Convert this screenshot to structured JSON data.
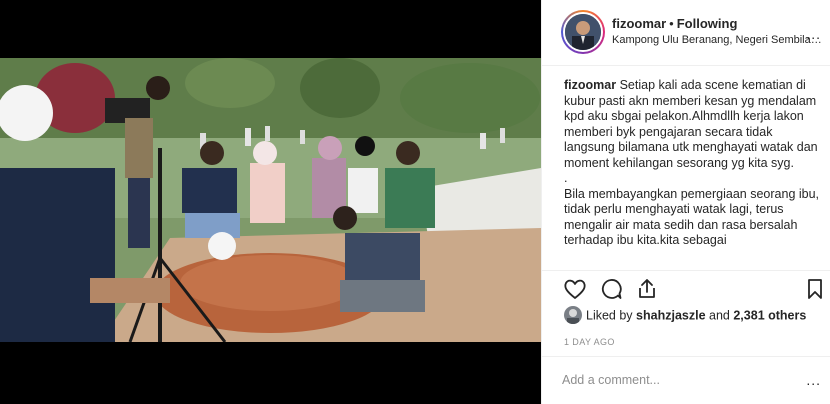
{
  "header": {
    "username": "fizoomar",
    "separator": "•",
    "follow_status": "Following",
    "location": "Kampong Ulu Beranang, Negeri Sembilan,...",
    "more": "..."
  },
  "caption": {
    "username": "fizoomar",
    "paragraph1": "Setiap kali ada scene kematian di kubur pasti akn memberi kesan yg mendalam kpd aku sbgai pelakon.Alhmdllh kerja lakon memberi byk pengajaran secara tidak langsung bilamana utk menghayati watak dan moment kehilangan sesorang yg kita syg.",
    "separator": ".",
    "paragraph2": "Bila membayangkan pemergiaan seorang ibu, tidak perlu menghayati watak lagi, terus mengalir air mata sedih dan rasa bersalah terhadap ibu kita.kita sebagai"
  },
  "actions": {
    "like": "heart-icon",
    "comment": "comment-icon",
    "share": "share-icon",
    "save": "bookmark-icon"
  },
  "likes": {
    "prefix": "Liked by",
    "user": "shahzjaszle",
    "and": "and",
    "count": "2,381 others"
  },
  "timestamp": "1 DAY AGO",
  "comment": {
    "placeholder": "Add a comment...",
    "more": "..."
  }
}
